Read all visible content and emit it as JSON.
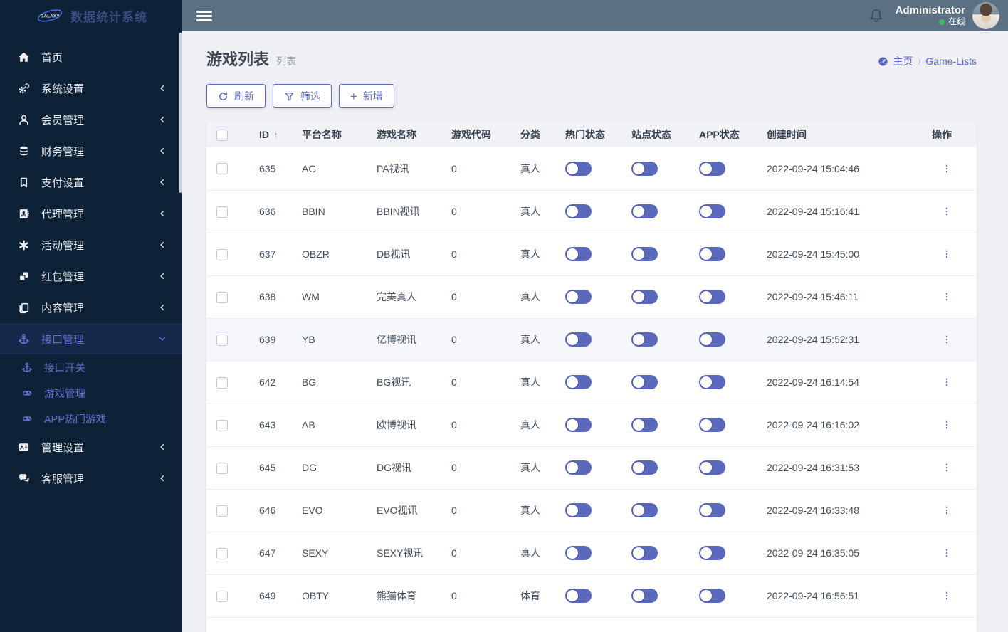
{
  "app": {
    "logo_text": "GALAXY",
    "title": "数据统计系统"
  },
  "topbar": {
    "username": "Administrator",
    "status": "在线"
  },
  "sidebar": {
    "items": [
      {
        "key": "home",
        "label": "首页",
        "icon": "home-icon",
        "chevron": null,
        "active": false
      },
      {
        "key": "system-settings",
        "label": "系统设置",
        "icon": "gears-icon",
        "chevron": "left",
        "active": false
      },
      {
        "key": "member-management",
        "label": "会员管理",
        "icon": "user-icon",
        "chevron": "left",
        "active": false
      },
      {
        "key": "finance-management",
        "label": "财务管理",
        "icon": "database-icon",
        "chevron": "left",
        "active": false
      },
      {
        "key": "payment-settings",
        "label": "支付设置",
        "icon": "bookmark-icon",
        "chevron": "left",
        "active": false
      },
      {
        "key": "agent-management",
        "label": "代理管理",
        "icon": "address-book-icon",
        "chevron": "left",
        "active": false
      },
      {
        "key": "activity-management",
        "label": "活动管理",
        "icon": "asterisk-icon",
        "chevron": "left",
        "active": false
      },
      {
        "key": "redpacket-management",
        "label": "红包管理",
        "icon": "cubes-icon",
        "chevron": "left",
        "active": false
      },
      {
        "key": "content-management",
        "label": "内容管理",
        "icon": "copy-icon",
        "chevron": "left",
        "active": false
      },
      {
        "key": "interface-management",
        "label": "接口管理",
        "icon": "anchor-icon",
        "chevron": "down",
        "active": true,
        "children": [
          {
            "key": "interface-switch",
            "label": "接口开关",
            "icon": "anchor-icon"
          },
          {
            "key": "game-management",
            "label": "游戏管理",
            "icon": "gamepad-icon"
          },
          {
            "key": "app-hot-games",
            "label": "APP热门游戏",
            "icon": "gamepad-icon"
          }
        ]
      },
      {
        "key": "admin-settings",
        "label": "管理设置",
        "icon": "id-card-icon",
        "chevron": "left",
        "active": false
      },
      {
        "key": "service-management",
        "label": "客服管理",
        "icon": "comments-icon",
        "chevron": "left",
        "active": false
      }
    ]
  },
  "page": {
    "title": "游戏列表",
    "subtitle": "列表",
    "breadcrumb": {
      "home": "主页",
      "separator": "/",
      "current": "Game-Lists"
    },
    "buttons": {
      "refresh": "刷新",
      "filter": "筛选",
      "add": "新增"
    }
  },
  "table": {
    "sort_column": "ID",
    "sort_direction": "asc",
    "highlighted_row_id": 639,
    "columns": [
      {
        "key": "select",
        "label": ""
      },
      {
        "key": "id",
        "label": "ID",
        "sortable": true
      },
      {
        "key": "platform",
        "label": "平台名称"
      },
      {
        "key": "game",
        "label": "游戏名称"
      },
      {
        "key": "code",
        "label": "游戏代码"
      },
      {
        "key": "category",
        "label": "分类"
      },
      {
        "key": "hot",
        "label": "热门状态"
      },
      {
        "key": "site",
        "label": "站点状态"
      },
      {
        "key": "app",
        "label": "APP状态"
      },
      {
        "key": "created",
        "label": "创建时间"
      },
      {
        "key": "actions",
        "label": "操作"
      }
    ],
    "rows": [
      {
        "id": 635,
        "platform": "AG",
        "game": "PA视讯",
        "code": "0",
        "category": "真人",
        "hot": true,
        "site": true,
        "app": true,
        "created": "2022-09-24 15:04:46"
      },
      {
        "id": 636,
        "platform": "BBIN",
        "game": "BBIN视讯",
        "code": "0",
        "category": "真人",
        "hot": true,
        "site": true,
        "app": true,
        "created": "2022-09-24 15:16:41"
      },
      {
        "id": 637,
        "platform": "OBZR",
        "game": "DB视讯",
        "code": "0",
        "category": "真人",
        "hot": true,
        "site": true,
        "app": true,
        "created": "2022-09-24 15:45:00"
      },
      {
        "id": 638,
        "platform": "WM",
        "game": "完美真人",
        "code": "0",
        "category": "真人",
        "hot": true,
        "site": true,
        "app": true,
        "created": "2022-09-24 15:46:11"
      },
      {
        "id": 639,
        "platform": "YB",
        "game": "亿博视讯",
        "code": "0",
        "category": "真人",
        "hot": true,
        "site": true,
        "app": true,
        "created": "2022-09-24 15:52:31"
      },
      {
        "id": 642,
        "platform": "BG",
        "game": "BG视讯",
        "code": "0",
        "category": "真人",
        "hot": true,
        "site": true,
        "app": true,
        "created": "2022-09-24 16:14:54"
      },
      {
        "id": 643,
        "platform": "AB",
        "game": "欧博视讯",
        "code": "0",
        "category": "真人",
        "hot": true,
        "site": true,
        "app": true,
        "created": "2022-09-24 16:16:02"
      },
      {
        "id": 645,
        "platform": "DG",
        "game": "DG视讯",
        "code": "0",
        "category": "真人",
        "hot": true,
        "site": true,
        "app": true,
        "created": "2022-09-24 16:31:53"
      },
      {
        "id": 646,
        "platform": "EVO",
        "game": "EVO视讯",
        "code": "0",
        "category": "真人",
        "hot": true,
        "site": true,
        "app": true,
        "created": "2022-09-24 16:33:48"
      },
      {
        "id": 647,
        "platform": "SEXY",
        "game": "SEXY视讯",
        "code": "0",
        "category": "真人",
        "hot": true,
        "site": true,
        "app": true,
        "created": "2022-09-24 16:35:05"
      },
      {
        "id": 649,
        "platform": "OBTY",
        "game": "熊猫体育",
        "code": "0",
        "category": "体育",
        "hot": true,
        "site": true,
        "app": true,
        "created": "2022-09-24 16:56:51"
      }
    ]
  },
  "colors": {
    "accent": "#5c6bc0",
    "sidebar_bg": "#0d2137",
    "sidebar_active_bg": "#15294a",
    "topbar_bg": "#5c7083",
    "page_bg": "#eef0f4",
    "table_header_bg": "#f1f2f6",
    "online_green": "#3fbf5c"
  }
}
